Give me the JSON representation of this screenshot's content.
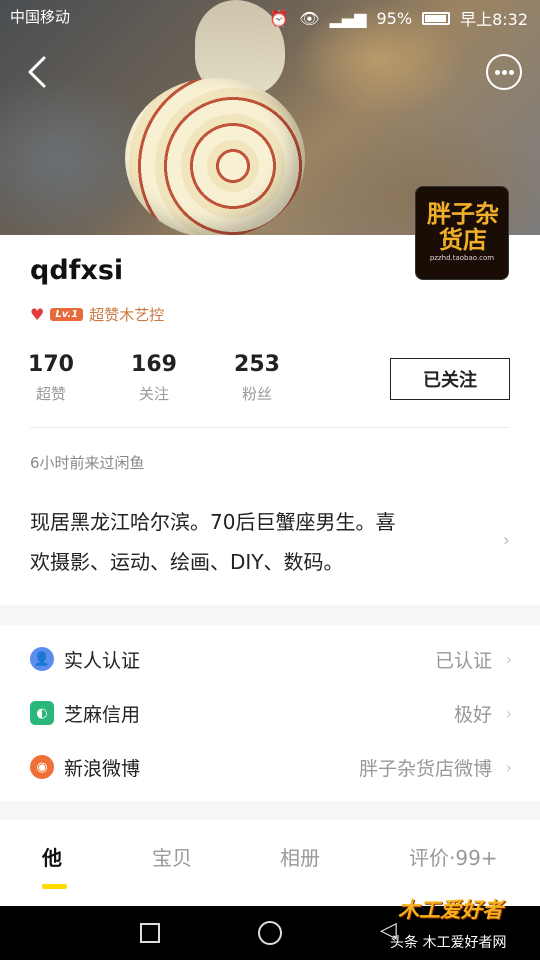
{
  "status_bar": {
    "left_text": "中国移动",
    "battery": "95%",
    "time": "早上8:32"
  },
  "avatar": {
    "big_text": "胖子杂货店",
    "url_text": "pzzhd.taobao.com"
  },
  "profile": {
    "nickname": "qdfxsi",
    "level_badge": "Lv.1",
    "level_title": "超赞木艺控",
    "stats": [
      {
        "value": "170",
        "label": "超赞"
      },
      {
        "value": "169",
        "label": "关注"
      },
      {
        "value": "253",
        "label": "粉丝"
      }
    ],
    "follow_button": "已关注",
    "last_visit": "6小时前来过闲鱼",
    "bio_line1": "现居黑龙江哈尔滨。70后巨蟹座男生。喜",
    "bio_line2": "欢摄影、运动、绘画、DIY、数码。"
  },
  "verification": [
    {
      "label": "实人认证",
      "value": "已认证",
      "icon": "person-verify-icon",
      "color": "#5b8def"
    },
    {
      "label": "芝麻信用",
      "value": "极好",
      "icon": "sesame-credit-icon",
      "color": "#2cb77a"
    },
    {
      "label": "新浪微博",
      "value": "胖子杂货店微博",
      "icon": "weibo-icon",
      "color": "#ef6f36"
    }
  ],
  "tabs": [
    {
      "label": "他",
      "active": true
    },
    {
      "label": "宝贝",
      "active": false
    },
    {
      "label": "相册",
      "active": false
    },
    {
      "label": "评价·99+",
      "active": false
    }
  ],
  "watermark": {
    "logo_text": "木工爱好者",
    "source_text": "头条  木工爱好者网"
  },
  "colors": {
    "accent_yellow": "#ffda00",
    "level_orange": "#c97940",
    "heart_red": "#e23b3b"
  }
}
